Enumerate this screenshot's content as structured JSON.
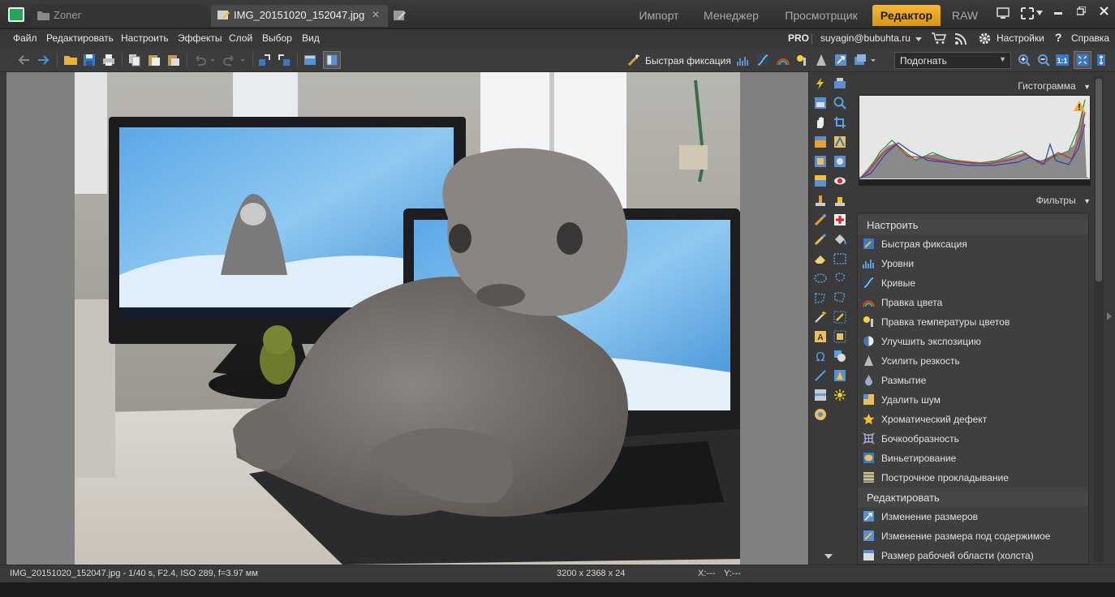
{
  "tabs": {
    "zoner": "Zoner",
    "image": "IMG_20151020_152047.jpg",
    "close": "✕"
  },
  "modules": {
    "import": "Импорт",
    "manager": "Менеджер",
    "viewer": "Просмотрщик",
    "editor": "Редактор",
    "raw": "RAW"
  },
  "menu": {
    "file": "Файл",
    "edit": "Редактировать",
    "adjust": "Настроить",
    "effects": "Эффекты",
    "layer": "Слой",
    "select": "Выбор",
    "view": "Вид"
  },
  "account": {
    "pro": "PRO",
    "email": "suyagin@bubuhta.ru",
    "settings": "Настройки",
    "help": "Справка"
  },
  "toolbar": {
    "quick_fix": "Быстрая фиксация",
    "fit_value": "Подогнать"
  },
  "panels": {
    "histogram": "Гистограмма",
    "filters": "Фильтры"
  },
  "filters": {
    "group_adjust": "Настроить",
    "group_edit": "Редактировать",
    "adjust_items": [
      "Быстрая фиксация",
      "Уровни",
      "Кривые",
      "Правка цвета",
      "Правка температуры цветов",
      "Улучшить экспозицию",
      "Усилить резкость",
      "Размытие",
      "Удалить шум",
      "Хроматический дефект",
      "Бочкообразность",
      "Виньетирование",
      "Построчное прокладывание"
    ],
    "edit_items": [
      "Изменение размеров",
      "Изменение размера под содержимое",
      "Размер рабочей области (холста)"
    ]
  },
  "status": {
    "file_info": "IMG_20151020_152047.jpg - 1/40 s, F2.4, ISO 289, f=3.97 мм",
    "dimensions": "3200 x 2368 x 24",
    "x": "X:---",
    "y": "Y:---"
  },
  "colors": {
    "accent": "#e8a21f",
    "background": "#3a3a3a"
  }
}
